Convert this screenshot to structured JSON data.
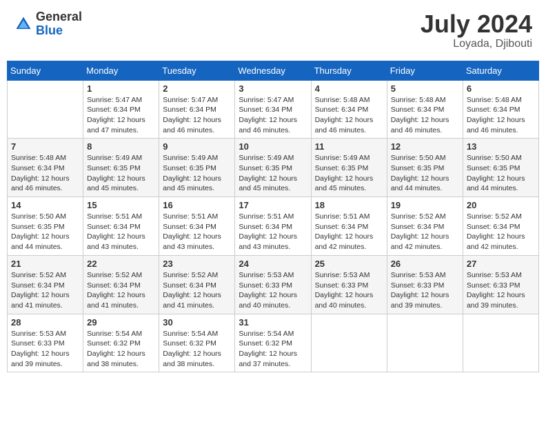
{
  "logo": {
    "general": "General",
    "blue": "Blue"
  },
  "title": {
    "month_year": "July 2024",
    "location": "Loyada, Djibouti"
  },
  "headers": [
    "Sunday",
    "Monday",
    "Tuesday",
    "Wednesday",
    "Thursday",
    "Friday",
    "Saturday"
  ],
  "weeks": [
    [
      {
        "day": "",
        "info": ""
      },
      {
        "day": "1",
        "info": "Sunrise: 5:47 AM\nSunset: 6:34 PM\nDaylight: 12 hours\nand 47 minutes."
      },
      {
        "day": "2",
        "info": "Sunrise: 5:47 AM\nSunset: 6:34 PM\nDaylight: 12 hours\nand 46 minutes."
      },
      {
        "day": "3",
        "info": "Sunrise: 5:47 AM\nSunset: 6:34 PM\nDaylight: 12 hours\nand 46 minutes."
      },
      {
        "day": "4",
        "info": "Sunrise: 5:48 AM\nSunset: 6:34 PM\nDaylight: 12 hours\nand 46 minutes."
      },
      {
        "day": "5",
        "info": "Sunrise: 5:48 AM\nSunset: 6:34 PM\nDaylight: 12 hours\nand 46 minutes."
      },
      {
        "day": "6",
        "info": "Sunrise: 5:48 AM\nSunset: 6:34 PM\nDaylight: 12 hours\nand 46 minutes."
      }
    ],
    [
      {
        "day": "7",
        "info": "Sunrise: 5:48 AM\nSunset: 6:34 PM\nDaylight: 12 hours\nand 46 minutes."
      },
      {
        "day": "8",
        "info": "Sunrise: 5:49 AM\nSunset: 6:35 PM\nDaylight: 12 hours\nand 45 minutes."
      },
      {
        "day": "9",
        "info": "Sunrise: 5:49 AM\nSunset: 6:35 PM\nDaylight: 12 hours\nand 45 minutes."
      },
      {
        "day": "10",
        "info": "Sunrise: 5:49 AM\nSunset: 6:35 PM\nDaylight: 12 hours\nand 45 minutes."
      },
      {
        "day": "11",
        "info": "Sunrise: 5:49 AM\nSunset: 6:35 PM\nDaylight: 12 hours\nand 45 minutes."
      },
      {
        "day": "12",
        "info": "Sunrise: 5:50 AM\nSunset: 6:35 PM\nDaylight: 12 hours\nand 44 minutes."
      },
      {
        "day": "13",
        "info": "Sunrise: 5:50 AM\nSunset: 6:35 PM\nDaylight: 12 hours\nand 44 minutes."
      }
    ],
    [
      {
        "day": "14",
        "info": "Sunrise: 5:50 AM\nSunset: 6:35 PM\nDaylight: 12 hours\nand 44 minutes."
      },
      {
        "day": "15",
        "info": "Sunrise: 5:51 AM\nSunset: 6:34 PM\nDaylight: 12 hours\nand 43 minutes."
      },
      {
        "day": "16",
        "info": "Sunrise: 5:51 AM\nSunset: 6:34 PM\nDaylight: 12 hours\nand 43 minutes."
      },
      {
        "day": "17",
        "info": "Sunrise: 5:51 AM\nSunset: 6:34 PM\nDaylight: 12 hours\nand 43 minutes."
      },
      {
        "day": "18",
        "info": "Sunrise: 5:51 AM\nSunset: 6:34 PM\nDaylight: 12 hours\nand 42 minutes."
      },
      {
        "day": "19",
        "info": "Sunrise: 5:52 AM\nSunset: 6:34 PM\nDaylight: 12 hours\nand 42 minutes."
      },
      {
        "day": "20",
        "info": "Sunrise: 5:52 AM\nSunset: 6:34 PM\nDaylight: 12 hours\nand 42 minutes."
      }
    ],
    [
      {
        "day": "21",
        "info": "Sunrise: 5:52 AM\nSunset: 6:34 PM\nDaylight: 12 hours\nand 41 minutes."
      },
      {
        "day": "22",
        "info": "Sunrise: 5:52 AM\nSunset: 6:34 PM\nDaylight: 12 hours\nand 41 minutes."
      },
      {
        "day": "23",
        "info": "Sunrise: 5:52 AM\nSunset: 6:34 PM\nDaylight: 12 hours\nand 41 minutes."
      },
      {
        "day": "24",
        "info": "Sunrise: 5:53 AM\nSunset: 6:33 PM\nDaylight: 12 hours\nand 40 minutes."
      },
      {
        "day": "25",
        "info": "Sunrise: 5:53 AM\nSunset: 6:33 PM\nDaylight: 12 hours\nand 40 minutes."
      },
      {
        "day": "26",
        "info": "Sunrise: 5:53 AM\nSunset: 6:33 PM\nDaylight: 12 hours\nand 39 minutes."
      },
      {
        "day": "27",
        "info": "Sunrise: 5:53 AM\nSunset: 6:33 PM\nDaylight: 12 hours\nand 39 minutes."
      }
    ],
    [
      {
        "day": "28",
        "info": "Sunrise: 5:53 AM\nSunset: 6:33 PM\nDaylight: 12 hours\nand 39 minutes."
      },
      {
        "day": "29",
        "info": "Sunrise: 5:54 AM\nSunset: 6:32 PM\nDaylight: 12 hours\nand 38 minutes."
      },
      {
        "day": "30",
        "info": "Sunrise: 5:54 AM\nSunset: 6:32 PM\nDaylight: 12 hours\nand 38 minutes."
      },
      {
        "day": "31",
        "info": "Sunrise: 5:54 AM\nSunset: 6:32 PM\nDaylight: 12 hours\nand 37 minutes."
      },
      {
        "day": "",
        "info": ""
      },
      {
        "day": "",
        "info": ""
      },
      {
        "day": "",
        "info": ""
      }
    ]
  ]
}
